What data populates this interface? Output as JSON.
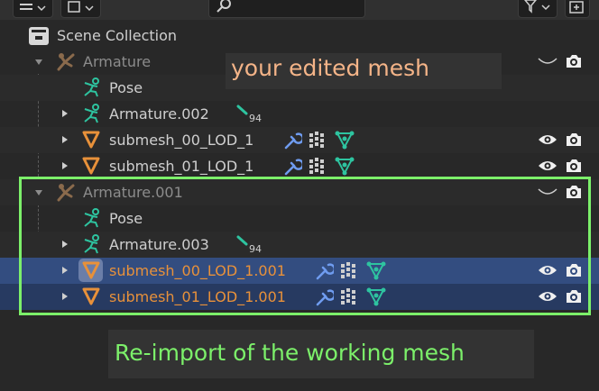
{
  "outliner": {
    "scene_collection": "Scene Collection",
    "rows": [
      {
        "label": "Armature"
      },
      {
        "label": "Pose"
      },
      {
        "label": "Armature.002",
        "count": "94"
      },
      {
        "label": "submesh_00_LOD_1"
      },
      {
        "label": "submesh_01_LOD_1"
      },
      {
        "label": "Armature.001"
      },
      {
        "label": "Pose"
      },
      {
        "label": "Armature.003",
        "count": "94"
      },
      {
        "label": "submesh_00_LOD_1.001"
      },
      {
        "label": "submesh_01_LOD_1.001"
      }
    ]
  },
  "annotations": {
    "top": "your edited mesh",
    "bottom": "Re-import of the working mesh"
  },
  "colors": {
    "accent_orange": "#e8913a",
    "armature_icon": "#d99048",
    "pose_icon": "#2ec4a0",
    "wrench": "#6f9cf0",
    "highlight_green": "#7cf06a",
    "selection": "#334d80"
  },
  "icons": [
    "filter-icon",
    "search-icon",
    "new-collection-icon",
    "collection-icon",
    "armature-icon",
    "pose-icon",
    "bone-count-icon",
    "modifier-wrench-icon",
    "vertex-groups-icon",
    "mesh-data-icon",
    "eye-icon",
    "camera-icon",
    "hide-toggle-icon"
  ]
}
